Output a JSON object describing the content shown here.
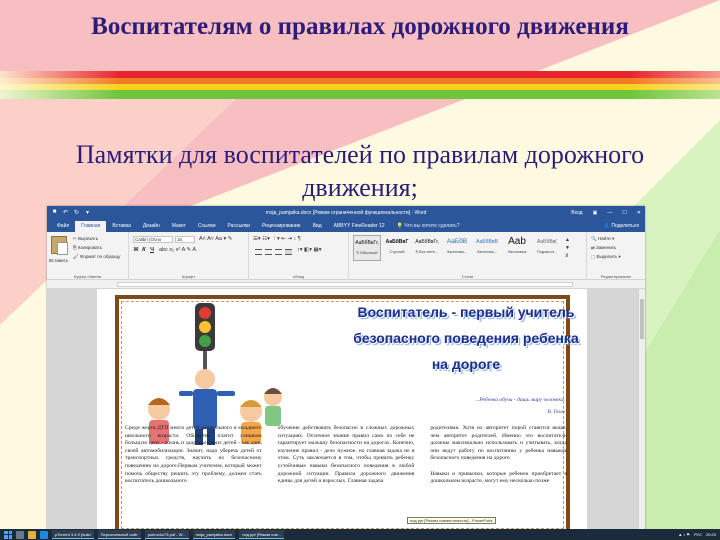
{
  "slide": {
    "title": "Воспитателям о правилах дорожного движения",
    "subtitle": "Памятки для воспитателей по правилам дорожного движения;",
    "colors": {
      "title": "#2b1c7a",
      "band_red": "#e9242e",
      "band_orange": "#f27b25",
      "band_yellow": "#f7d21d",
      "band_green": "#6fc53a"
    }
  },
  "word": {
    "window_title": "moja_pamjatka.docx [Режим ограниченной функциональности] - Word",
    "user": "Вход",
    "quick_access": [
      "save-icon",
      "undo-icon",
      "redo-icon",
      "customize-icon"
    ],
    "tabs": [
      "Файл",
      "Главная",
      "Вставка",
      "Дизайн",
      "Макет",
      "Ссылки",
      "Рассылки",
      "Рецензирование",
      "Вид",
      "ABBYY FineReader 12"
    ],
    "tell_me": "Что вы хотите сделать?",
    "share": "Поделиться",
    "ribbon": {
      "paste": "Вставить",
      "cut": "Вырезать",
      "copy": "Копировать",
      "format_painter": "Формат по образцу",
      "clipboard_label": "Буфер обмена",
      "font_name": "Calibri (Осно",
      "font_size": "16",
      "font_label": "Шрифт",
      "paragraph_label": "Абзац",
      "styles_label": "Стили",
      "styles": [
        {
          "sample": "АаБбВвГг,",
          "name": "¶ Обычный"
        },
        {
          "sample": "АаБбВвГ",
          "name": "Строгий"
        },
        {
          "sample": "АаБбВвГг,",
          "name": "¶ Без инте..."
        },
        {
          "sample": "АаБбВ",
          "name": "Заголово..."
        },
        {
          "sample": "АаБбВвВ",
          "name": "Заголово..."
        },
        {
          "sample": "Aab",
          "name": "Заголовок"
        },
        {
          "sample": "АаБбВв(",
          "name": "Подзагол..."
        }
      ],
      "find": "Найти",
      "replace": "Заменить",
      "select": "Выделить",
      "editing_label": "Редактирование"
    },
    "document": {
      "heading_lines": [
        "Воспитатель - первый учитель",
        "безопасного поведения ребенка",
        "на дороге"
      ],
      "quote": "...Ребенка обучи - дашь миру человека.",
      "quote_author": "В. Гюго",
      "columns": [
        "Среди жертв ДТП много детей дошкольного и младшего школьного возраста. Общество платит слишком большую цену - жизнь и здоровье своих детей - как дань своей автомобилизации. Значит, надо уберечь детей от транспортных средств, научить их безопасному поведению на дороге.Первым учителем, который может помочь обществу решить эту проблему, должен стать воспитатель дошкольного",
        "обучение действовать безопасно в сложных дорожных ситуациях. Отличное знание правил само по себе не гарантирует малышу безопасности на дорогах. Конечно, изучение правил - дело нужное, но главная задача не в этом. Суть заключается в том, чтобы привить ребенку устойчивые навыки безопасного поведения в любой дорожной ситуации. Правила дорожного движения едины для детей и взрослых. Главная задача",
        "родителями. Хотя их авторитет порой ставится выше, чем авторитет родителей. Именно это воспитатели должны максимально использовать и учитывать, когда они ведут работу по воспитанию у ребенка навыков безопасного поведения на дороге.\n\nНавыки и привычки, которые ребенок приобретает в дошкольном возрасте, могут ему несколько позже"
      ]
    },
    "status": {
      "page": "Страница 1 из 4",
      "words": "Число слов: 877",
      "language": "русский",
      "zoom": "100 %"
    },
    "tooltip": "под.ppt [Режим совместимости] - PowerPoint"
  },
  "taskbar": {
    "items": [
      "µTorrent 3.4.9 (build",
      "Персональный сайт",
      "pokrovko73.pdf - W...",
      "moja_pamjatka.docx",
      "под.ppt [Режим сов..."
    ],
    "time": "20:23",
    "lang": "РУС"
  }
}
